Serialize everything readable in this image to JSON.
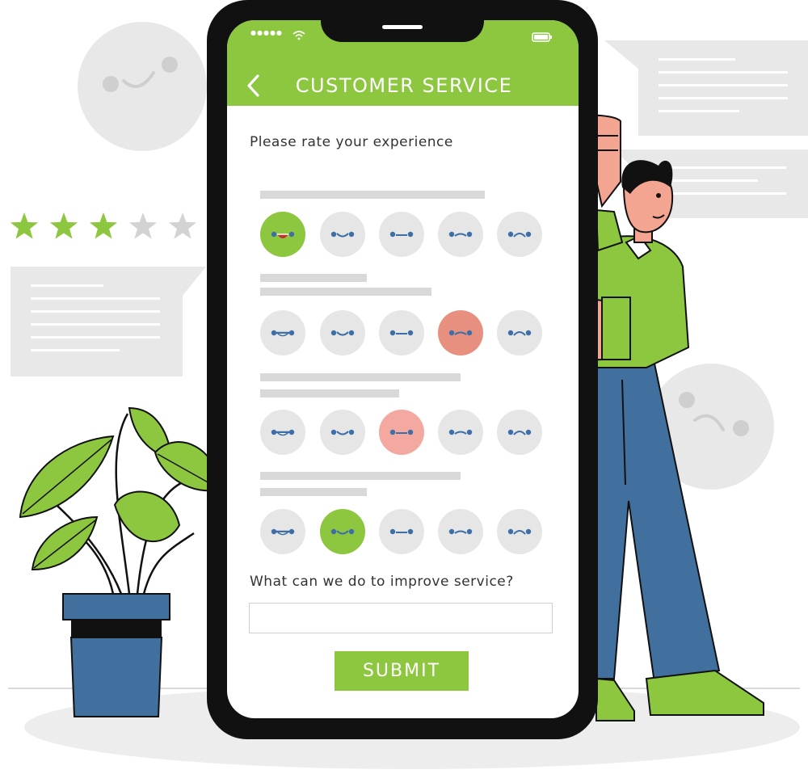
{
  "status_bar": {
    "signal": "●●●●●",
    "wifi": "wifi-icon",
    "battery": "battery-icon"
  },
  "header": {
    "back_icon": "chevron-left-icon",
    "title": "CUSTOMER SERVICE"
  },
  "survey": {
    "prompt": "Please rate your experience",
    "questions": [
      {
        "selected": 1,
        "selected_tone": "green"
      },
      {
        "selected": 4,
        "selected_tone": "red"
      },
      {
        "selected": 3,
        "selected_tone": "pink"
      },
      {
        "selected": 2,
        "selected_tone": "green"
      }
    ],
    "faces": [
      "grin",
      "smile",
      "neutral",
      "frown",
      "sad"
    ]
  },
  "feedback": {
    "prompt": "What can we do to improve service?",
    "value": "",
    "placeholder": ""
  },
  "submit_label": "SUBMIT",
  "decor": {
    "stars_filled": 3,
    "stars_total": 5
  },
  "colors": {
    "accent": "#8dc63f",
    "red_face": "#e8907f",
    "pink_face": "#f3a9a0",
    "neutral_face": "#e6e6e6",
    "eye": "#3d6ea8"
  }
}
